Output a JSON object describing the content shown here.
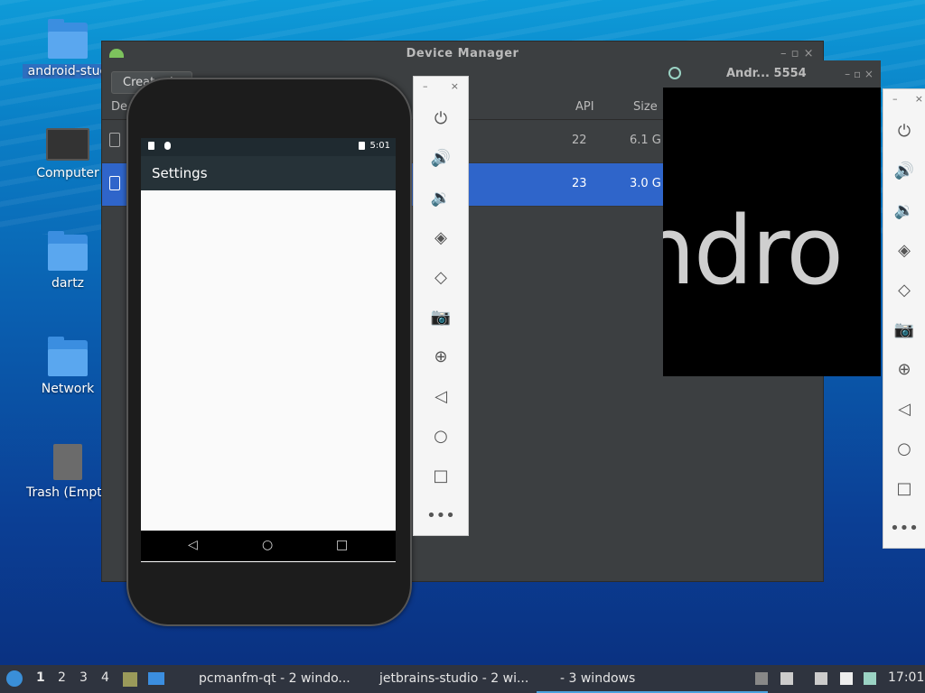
{
  "desktop": {
    "icons": [
      {
        "label": "android-stud",
        "selected": true
      },
      {
        "label": "Computer"
      },
      {
        "label": "dartz"
      },
      {
        "label": "Network"
      },
      {
        "label": "Trash (Empty"
      }
    ]
  },
  "device_manager": {
    "title": "Device Manager",
    "create_button": "Create de",
    "columns": {
      "device": "De",
      "api": "API",
      "size": "Size"
    },
    "rows": [
      {
        "api": "22",
        "size": "6.1 G"
      },
      {
        "api": "23",
        "size": "3.0 G"
      }
    ]
  },
  "phone": {
    "time": "5:01",
    "app_title": "Settings"
  },
  "emulator2": {
    "title": "Andr... 5554",
    "boot_text": "ndro"
  },
  "toolbar_controls": {
    "minimize": "–",
    "close": "×",
    "more": "•••"
  },
  "taskbar": {
    "workspaces": [
      "1",
      "2",
      "3",
      "4"
    ],
    "tasks": [
      {
        "label": "pcmanfm-qt - 2 windo..."
      },
      {
        "label": "jetbrains-studio - 2 wi..."
      },
      {
        "label": "- 3 windows"
      }
    ],
    "clock": "17:01"
  },
  "colors": {
    "selection": "#2f65ca",
    "taskbar_bg": "#2f343f"
  }
}
